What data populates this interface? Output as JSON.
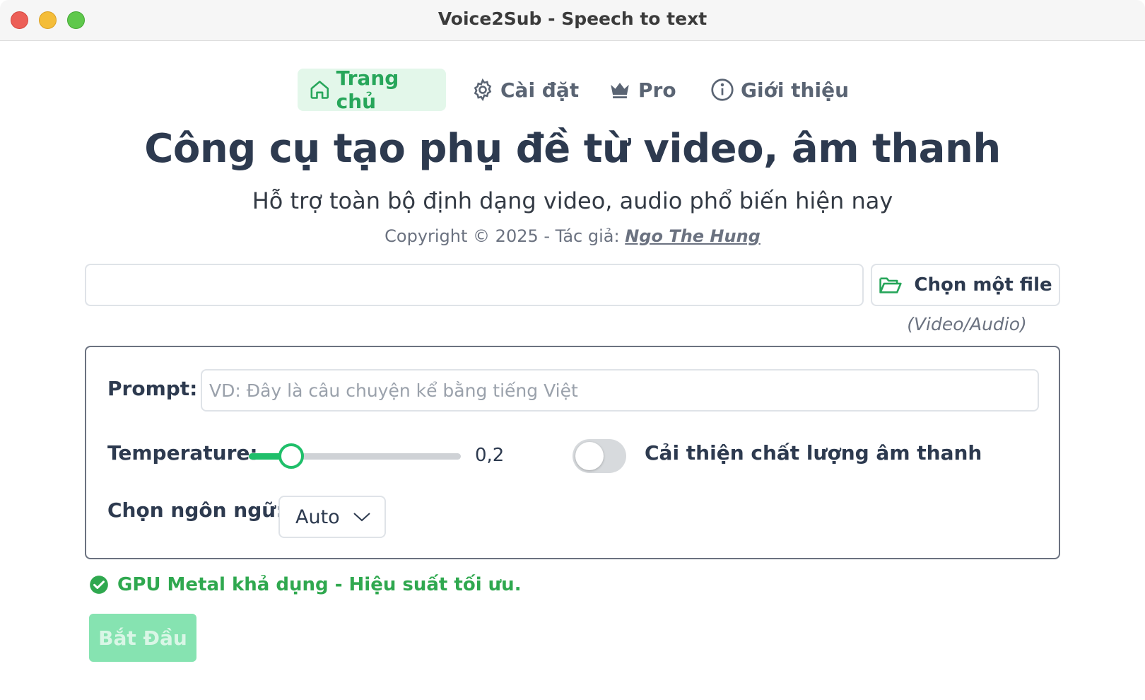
{
  "window": {
    "title": "Voice2Sub - Speech to text"
  },
  "nav": {
    "items": [
      {
        "label": "Trang chủ",
        "icon": "home-icon",
        "active": true
      },
      {
        "label": "Cài đặt",
        "icon": "gear-icon",
        "active": false
      },
      {
        "label": "Pro",
        "icon": "crown-icon",
        "active": false
      },
      {
        "label": "Giới thiệu",
        "icon": "info-icon",
        "active": false
      }
    ]
  },
  "header": {
    "title": "Công cụ tạo phụ đề từ video, âm thanh",
    "subtitle": "Hỗ trợ toàn bộ định dạng video, audio phổ biến hiện nay",
    "copyright": "Copyright © 2025 - Tác giả:",
    "author": "Ngo The Hung"
  },
  "file": {
    "path_value": "",
    "choose_label": "Chọn một file",
    "hint": "(Video/Audio)"
  },
  "options": {
    "prompt_label": "Prompt:",
    "prompt_placeholder": "VD: Đây là câu chuyện kể bằng tiếng Việt",
    "temperature_label": "Temperature:",
    "temperature_value": "0,2",
    "temperature_fraction": 0.2,
    "enhance_label": "Cải thiện chất lượng âm thanh",
    "enhance_enabled": false,
    "language_label": "Chọn ngôn ngữ:",
    "language_value": "Auto"
  },
  "status": {
    "message": "GPU Metal khả dụng - Hiệu suất tối ưu."
  },
  "start_button": {
    "label": "Bắt Đầu"
  },
  "colors": {
    "accent": "#1fbf6a",
    "status_green": "#2fa84f",
    "active_nav_bg": "#e3f7ea"
  }
}
